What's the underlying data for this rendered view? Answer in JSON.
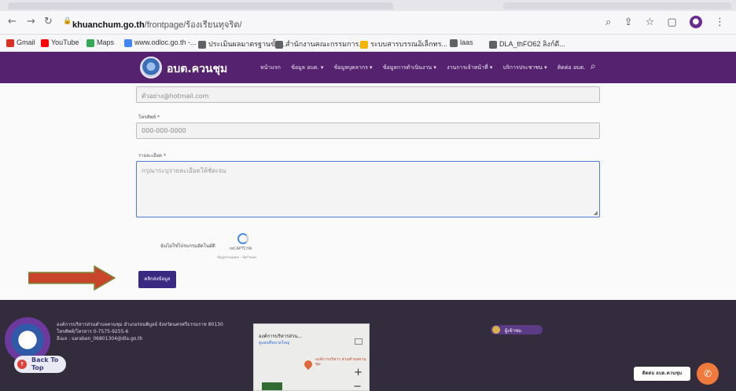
{
  "browser": {
    "url_host": "khuanchum.go.th",
    "url_path": "/frontpage/ร้องเรียนทุจริต/",
    "bookmarks": [
      {
        "label": "Gmail",
        "color": "#d93025"
      },
      {
        "label": "YouTube",
        "color": "#ff0000"
      },
      {
        "label": "Maps",
        "color": "#34a853"
      },
      {
        "label": "www.odloc.go.th -...",
        "color": "#4285f4"
      },
      {
        "label": "ประเมินผลมาตรฐานขั้น...",
        "color": "#5f6368"
      },
      {
        "label": "สำนักงานคณะกรรมการ...",
        "color": "#5f6368"
      },
      {
        "label": "ระบบสารบรรณอิเล็กทร...",
        "color": "#f4b400"
      },
      {
        "label": "laas",
        "color": "#5f6368"
      },
      {
        "label": "DLA_thFO62 ลิงก์ดี...",
        "color": "#5f6368"
      }
    ]
  },
  "header": {
    "brand": "อบต.ควนชุม",
    "menu": [
      "หน้าแรก",
      "ข้อมูล อบต. ▾",
      "ข้อมูลบุคลากร ▾",
      "ข้อมูลการดำเนินงาน ▾",
      "งานการเจ้าหน้าที่ ▾",
      "บริการประชาชน ▾",
      "ติดต่อ อบต."
    ],
    "search_icon": "search-icon"
  },
  "form": {
    "email_value": "ตัวอย่าง@hotmail.com",
    "phone_label": "โทรศัพท์ *",
    "phone_value": "000-000-0000",
    "detail_label": "รายละเอียด *",
    "detail_placeholder": "กรุณาระบุรายละเอียดให้ชัดเจน",
    "captcha_text": "ฉันไม่ใช่โปรแกรมอัตโนมัติ",
    "captcha_brand": "reCAPTCHA",
    "captcha_terms": "ข้อมูลส่วนบุคคล - ข้อกำหนด",
    "submit_label": "คลิกส่งข้อมูล"
  },
  "footer": {
    "address_line1": "องค์การบริหารส่วนตำบลควนชุม อำเภอร่อนพิบูลย์ จังหวัดนครศรีธรรมราช 80130",
    "address_line2": "โทรศัพท์/โทรสาร 0-7575-9255-6",
    "address_line3": "อีเมล : saraban_06801304@dla.go.th",
    "back_to_top": "Back To Top",
    "map_title": "องค์การบริหารส่วน...",
    "map_link": "ดูแผนที่ขนาดใหญ่",
    "map_pin_label": "องค์การบริหาร ส่วนตำบลควนชุม",
    "visitor_label": "ผู้เข้าชม",
    "contact_label": "ติดต่อ อบต.ควนชุม"
  },
  "colors": {
    "header_purple": "#55226f",
    "footer_dark": "#332c3d",
    "submit_blue": "#3b2a82",
    "arrow_red": "#c8452b"
  }
}
